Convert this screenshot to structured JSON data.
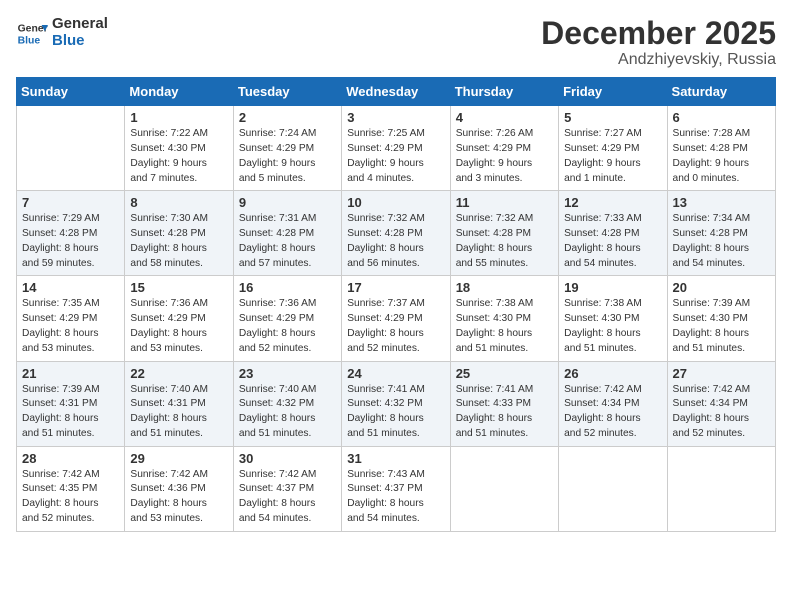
{
  "header": {
    "logo_line1": "General",
    "logo_line2": "Blue",
    "month": "December 2025",
    "location": "Andzhiyevskiy, Russia"
  },
  "weekdays": [
    "Sunday",
    "Monday",
    "Tuesday",
    "Wednesday",
    "Thursday",
    "Friday",
    "Saturday"
  ],
  "weeks": [
    [
      {
        "day": "",
        "info": ""
      },
      {
        "day": "1",
        "info": "Sunrise: 7:22 AM\nSunset: 4:30 PM\nDaylight: 9 hours\nand 7 minutes."
      },
      {
        "day": "2",
        "info": "Sunrise: 7:24 AM\nSunset: 4:29 PM\nDaylight: 9 hours\nand 5 minutes."
      },
      {
        "day": "3",
        "info": "Sunrise: 7:25 AM\nSunset: 4:29 PM\nDaylight: 9 hours\nand 4 minutes."
      },
      {
        "day": "4",
        "info": "Sunrise: 7:26 AM\nSunset: 4:29 PM\nDaylight: 9 hours\nand 3 minutes."
      },
      {
        "day": "5",
        "info": "Sunrise: 7:27 AM\nSunset: 4:29 PM\nDaylight: 9 hours\nand 1 minute."
      },
      {
        "day": "6",
        "info": "Sunrise: 7:28 AM\nSunset: 4:28 PM\nDaylight: 9 hours\nand 0 minutes."
      }
    ],
    [
      {
        "day": "7",
        "info": "Sunrise: 7:29 AM\nSunset: 4:28 PM\nDaylight: 8 hours\nand 59 minutes."
      },
      {
        "day": "8",
        "info": "Sunrise: 7:30 AM\nSunset: 4:28 PM\nDaylight: 8 hours\nand 58 minutes."
      },
      {
        "day": "9",
        "info": "Sunrise: 7:31 AM\nSunset: 4:28 PM\nDaylight: 8 hours\nand 57 minutes."
      },
      {
        "day": "10",
        "info": "Sunrise: 7:32 AM\nSunset: 4:28 PM\nDaylight: 8 hours\nand 56 minutes."
      },
      {
        "day": "11",
        "info": "Sunrise: 7:32 AM\nSunset: 4:28 PM\nDaylight: 8 hours\nand 55 minutes."
      },
      {
        "day": "12",
        "info": "Sunrise: 7:33 AM\nSunset: 4:28 PM\nDaylight: 8 hours\nand 54 minutes."
      },
      {
        "day": "13",
        "info": "Sunrise: 7:34 AM\nSunset: 4:28 PM\nDaylight: 8 hours\nand 54 minutes."
      }
    ],
    [
      {
        "day": "14",
        "info": "Sunrise: 7:35 AM\nSunset: 4:29 PM\nDaylight: 8 hours\nand 53 minutes."
      },
      {
        "day": "15",
        "info": "Sunrise: 7:36 AM\nSunset: 4:29 PM\nDaylight: 8 hours\nand 53 minutes."
      },
      {
        "day": "16",
        "info": "Sunrise: 7:36 AM\nSunset: 4:29 PM\nDaylight: 8 hours\nand 52 minutes."
      },
      {
        "day": "17",
        "info": "Sunrise: 7:37 AM\nSunset: 4:29 PM\nDaylight: 8 hours\nand 52 minutes."
      },
      {
        "day": "18",
        "info": "Sunrise: 7:38 AM\nSunset: 4:30 PM\nDaylight: 8 hours\nand 51 minutes."
      },
      {
        "day": "19",
        "info": "Sunrise: 7:38 AM\nSunset: 4:30 PM\nDaylight: 8 hours\nand 51 minutes."
      },
      {
        "day": "20",
        "info": "Sunrise: 7:39 AM\nSunset: 4:30 PM\nDaylight: 8 hours\nand 51 minutes."
      }
    ],
    [
      {
        "day": "21",
        "info": "Sunrise: 7:39 AM\nSunset: 4:31 PM\nDaylight: 8 hours\nand 51 minutes."
      },
      {
        "day": "22",
        "info": "Sunrise: 7:40 AM\nSunset: 4:31 PM\nDaylight: 8 hours\nand 51 minutes."
      },
      {
        "day": "23",
        "info": "Sunrise: 7:40 AM\nSunset: 4:32 PM\nDaylight: 8 hours\nand 51 minutes."
      },
      {
        "day": "24",
        "info": "Sunrise: 7:41 AM\nSunset: 4:32 PM\nDaylight: 8 hours\nand 51 minutes."
      },
      {
        "day": "25",
        "info": "Sunrise: 7:41 AM\nSunset: 4:33 PM\nDaylight: 8 hours\nand 51 minutes."
      },
      {
        "day": "26",
        "info": "Sunrise: 7:42 AM\nSunset: 4:34 PM\nDaylight: 8 hours\nand 52 minutes."
      },
      {
        "day": "27",
        "info": "Sunrise: 7:42 AM\nSunset: 4:34 PM\nDaylight: 8 hours\nand 52 minutes."
      }
    ],
    [
      {
        "day": "28",
        "info": "Sunrise: 7:42 AM\nSunset: 4:35 PM\nDaylight: 8 hours\nand 52 minutes."
      },
      {
        "day": "29",
        "info": "Sunrise: 7:42 AM\nSunset: 4:36 PM\nDaylight: 8 hours\nand 53 minutes."
      },
      {
        "day": "30",
        "info": "Sunrise: 7:42 AM\nSunset: 4:37 PM\nDaylight: 8 hours\nand 54 minutes."
      },
      {
        "day": "31",
        "info": "Sunrise: 7:43 AM\nSunset: 4:37 PM\nDaylight: 8 hours\nand 54 minutes."
      },
      {
        "day": "",
        "info": ""
      },
      {
        "day": "",
        "info": ""
      },
      {
        "day": "",
        "info": ""
      }
    ]
  ]
}
